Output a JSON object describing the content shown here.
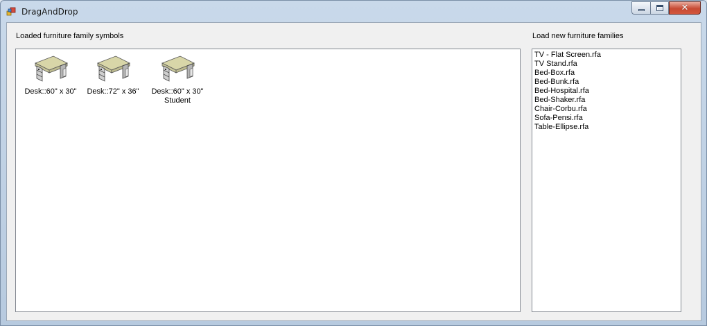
{
  "window": {
    "title": "DragAndDrop",
    "close_glyph": "✕"
  },
  "left_panel": {
    "label": "Loaded furniture family symbols",
    "symbols": [
      {
        "icon": "desk-icon",
        "label": "Desk::60\" x 30\""
      },
      {
        "icon": "desk-icon",
        "label": "Desk::72\" x 36\""
      },
      {
        "icon": "desk-icon",
        "label": "Desk::60\" x 30\" Student"
      }
    ]
  },
  "right_panel": {
    "label": "Load new furniture families",
    "items": [
      "TV - Flat Screen.rfa",
      "TV Stand.rfa",
      "Bed-Box.rfa",
      "Bed-Bunk.rfa",
      "Bed-Hospital.rfa",
      "Bed-Shaker.rfa",
      "Chair-Corbu.rfa",
      "Sofa-Pensi.rfa",
      "Table-Ellipse.rfa"
    ]
  },
  "colors": {
    "desk_top": "#d8d6a8",
    "desk_body": "#b5b5b5"
  }
}
